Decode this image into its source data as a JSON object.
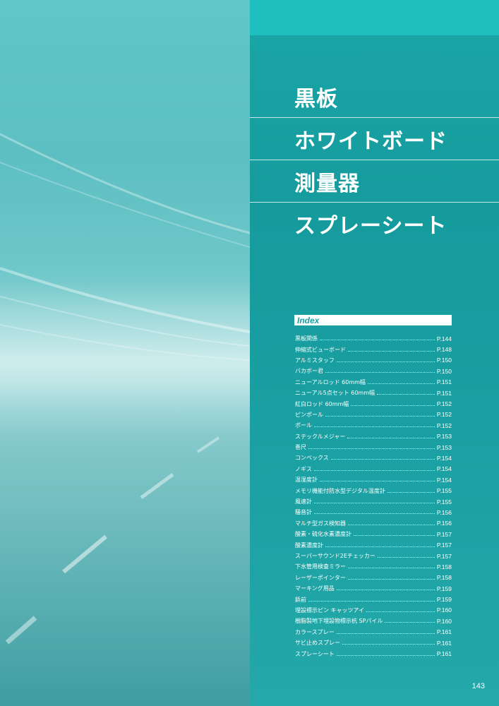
{
  "titles": [
    "黒板",
    "ホワイトボード",
    "測量器",
    "スプレーシート"
  ],
  "index": {
    "heading": "Index",
    "items": [
      {
        "name": "黒板関係",
        "page": "P.144"
      },
      {
        "name": "伸縮式ビューボード",
        "page": "P.148"
      },
      {
        "name": "アルミスタッフ",
        "page": "P.150"
      },
      {
        "name": "バカボー君",
        "page": "P.150"
      },
      {
        "name": "ニューアルロッド 60mm幅",
        "page": "P.151"
      },
      {
        "name": "ニューアル5点セット 60mm幅",
        "page": "P.151"
      },
      {
        "name": "紅白ロッド 60mm幅",
        "page": "P.152"
      },
      {
        "name": "ピンポール",
        "page": "P.152"
      },
      {
        "name": "ポール",
        "page": "P.152"
      },
      {
        "name": "ステックルメジャー",
        "page": "P.153"
      },
      {
        "name": "巻尺",
        "page": "P.153"
      },
      {
        "name": "コンベックス",
        "page": "P.154"
      },
      {
        "name": "ノギス",
        "page": "P.154"
      },
      {
        "name": "温湿度計",
        "page": "P.154"
      },
      {
        "name": "メモリ機能付防水型デジタル温度計",
        "page": "P.155"
      },
      {
        "name": "風速計",
        "page": "P.155"
      },
      {
        "name": "騒音計",
        "page": "P.156"
      },
      {
        "name": "マルチ型ガス検知器",
        "page": "P.156"
      },
      {
        "name": "酸素・硫化水素濃度計",
        "page": "P.157"
      },
      {
        "name": "酸素濃度計",
        "page": "P.157"
      },
      {
        "name": "スーパーサウンド2Eチェッカー",
        "page": "P.157"
      },
      {
        "name": "下水管用検査ミラー",
        "page": "P.158"
      },
      {
        "name": "レーザーポインター",
        "page": "P.158"
      },
      {
        "name": "マーキング用品",
        "page": "P.159"
      },
      {
        "name": "鋲前",
        "page": "P.159"
      },
      {
        "name": "埋設標示ピン キャッツアイ",
        "page": "P.160"
      },
      {
        "name": "樹脂製地下埋設物標示杭 SPパイル",
        "page": "P.160"
      },
      {
        "name": "カラースプレー",
        "page": "P.161"
      },
      {
        "name": "サビ止めスプレー",
        "page": "P.161"
      },
      {
        "name": "スプレーシート",
        "page": "P.161"
      }
    ]
  },
  "page_number": "143",
  "colors": {
    "panel_teal": "#1aa0a2",
    "top_strip": "#1fbfbf",
    "photo_teal": "#62c6c8",
    "text": "#ffffff"
  }
}
